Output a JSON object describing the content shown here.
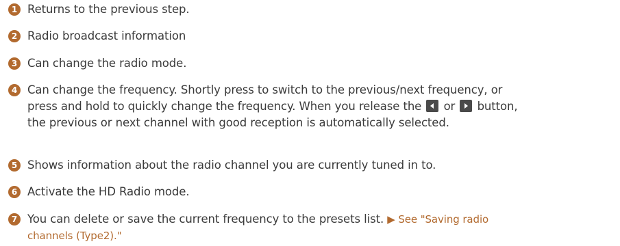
{
  "items": [
    {
      "number": "1",
      "text": "Returns to the previous step."
    },
    {
      "number": "2",
      "text": "Radio broadcast information"
    },
    {
      "number": "3",
      "text": "Can change the radio mode."
    },
    {
      "number": "4",
      "line1": "Can change the frequency. Shortly press to switch to the previous/next frequency, or",
      "line2_before": "press and hold to quickly change the frequency. When you release the",
      "line2_or": "or",
      "line2_after": "button,",
      "line3": "the previous or next channel with good reception is automatically selected.",
      "prev_icon": "prev-triangle-icon",
      "next_icon": "next-triangle-icon"
    },
    {
      "number": "5",
      "text": "Shows information about the radio channel you are currently tuned in to."
    },
    {
      "number": "6",
      "text": "Activate the HD Radio mode."
    },
    {
      "number": "7",
      "text": "You can delete or save the current frequency to the presets list.",
      "link_line1": "▶ See \"Saving radio",
      "link_line2": "channels (Type2).\""
    }
  ],
  "colors": {
    "accent": "#b26a2f",
    "text": "#3a3a3a",
    "button": "#4a4a4a"
  }
}
